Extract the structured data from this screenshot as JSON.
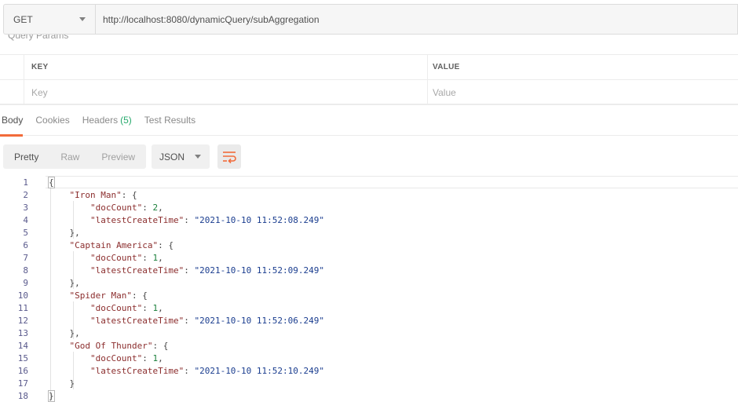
{
  "request": {
    "method": "GET",
    "url": "http://localhost:8080/dynamicQuery/subAggregation"
  },
  "query_params": {
    "title": "Query Params",
    "columns": {
      "key": "KEY",
      "value": "VALUE"
    },
    "key_placeholder": "Key",
    "value_placeholder": "Value"
  },
  "response_tabs": [
    {
      "label": "Body"
    },
    {
      "label": "Cookies"
    },
    {
      "label": "Headers",
      "count": "(5)"
    },
    {
      "label": "Test Results"
    }
  ],
  "toolbar": {
    "views": [
      "Pretty",
      "Raw",
      "Preview"
    ],
    "format": "JSON"
  },
  "code_lines": [
    {
      "num": "1",
      "t": "{"
    },
    {
      "num": "2",
      "t": "    \"Iron Man\": {"
    },
    {
      "num": "3",
      "t": "        \"docCount\": 2,"
    },
    {
      "num": "4",
      "t": "        \"latestCreateTime\": \"2021-10-10 11:52:08.249\""
    },
    {
      "num": "5",
      "t": "    },"
    },
    {
      "num": "6",
      "t": "    \"Captain America\": {"
    },
    {
      "num": "7",
      "t": "        \"docCount\": 1,"
    },
    {
      "num": "8",
      "t": "        \"latestCreateTime\": \"2021-10-10 11:52:09.249\""
    },
    {
      "num": "9",
      "t": "    },"
    },
    {
      "num": "10",
      "t": "    \"Spider Man\": {"
    },
    {
      "num": "11",
      "t": "        \"docCount\": 1,"
    },
    {
      "num": "12",
      "t": "        \"latestCreateTime\": \"2021-10-10 11:52:06.249\""
    },
    {
      "num": "13",
      "t": "    },"
    },
    {
      "num": "14",
      "t": "    \"God Of Thunder\": {"
    },
    {
      "num": "15",
      "t": "        \"docCount\": 1,"
    },
    {
      "num": "16",
      "t": "        \"latestCreateTime\": \"2021-10-10 11:52:10.249\""
    },
    {
      "num": "17",
      "t": "    }"
    },
    {
      "num": "18",
      "t": "}"
    }
  ],
  "colors": {
    "accent": "#f26b3a",
    "count_green": "#26a96c",
    "json_key": "#8b2d2d",
    "json_string": "#1a3d8f",
    "json_number": "#1a7f3a"
  }
}
